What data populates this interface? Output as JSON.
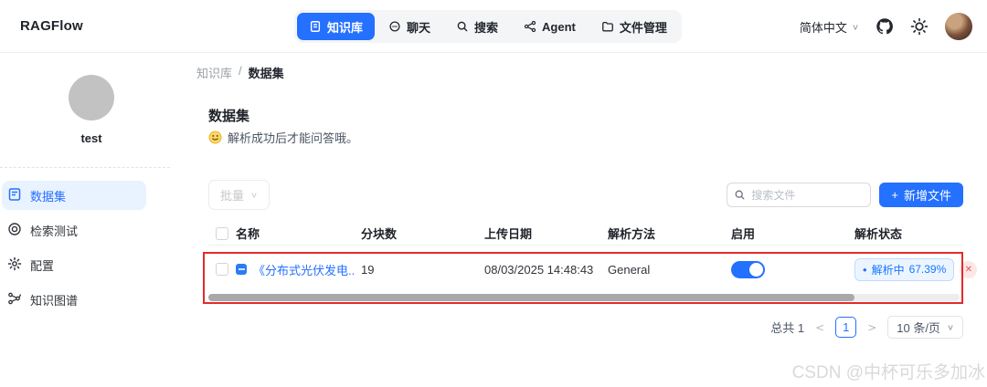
{
  "navbar": {
    "logo": "RAGFlow",
    "tabs": [
      {
        "label": "知识库",
        "icon": "knowledge-base-icon",
        "active": true
      },
      {
        "label": "聊天",
        "icon": "chat-icon",
        "active": false
      },
      {
        "label": "搜索",
        "icon": "search-icon",
        "active": false
      },
      {
        "label": "Agent",
        "icon": "agent-icon",
        "active": false
      },
      {
        "label": "文件管理",
        "icon": "file-manager-icon",
        "active": false
      }
    ],
    "language": "简体中文"
  },
  "sidebar": {
    "kb_name": "test",
    "items": [
      {
        "label": "数据集",
        "icon": "dataset-icon",
        "active": true
      },
      {
        "label": "检索测试",
        "icon": "retrieval-test-icon",
        "active": false
      },
      {
        "label": "配置",
        "icon": "settings-icon",
        "active": false
      },
      {
        "label": "知识图谱",
        "icon": "knowledge-graph-icon",
        "active": false
      }
    ]
  },
  "breadcrumb": {
    "parent": "知识库",
    "separator": "/",
    "current": "数据集"
  },
  "main": {
    "title": "数据集",
    "subtitle": "解析成功后才能问答哦。",
    "bulk_button": "批量",
    "search_placeholder": "搜索文件",
    "add_button_plus": "+",
    "add_button": "新增文件"
  },
  "table": {
    "headers": [
      "名称",
      "分块数",
      "上传日期",
      "解析方法",
      "启用",
      "解析状态"
    ],
    "rows": [
      {
        "name": "《分布式光伏发电...",
        "chunks": "19",
        "upload_date": "08/03/2025 14:48:43",
        "parse_method": "General",
        "enabled": true,
        "status_label": "解析中",
        "status_percent": "67.39%"
      }
    ]
  },
  "pagination": {
    "total": "总共 1",
    "prev": "<",
    "page": "1",
    "next": ">",
    "page_size": "10 条/页"
  },
  "icons": {
    "chevron": "∨",
    "close": "✕",
    "status_dot": "•"
  },
  "colors": {
    "accent": "#2470ff",
    "status_bg": "#ecf5ff",
    "status_text": "#1677ff",
    "danger": "#ef5350",
    "annotation_red": "#e22b2b",
    "sidebar_active_bg": "#e9f2ff"
  },
  "watermark": "CSDN @中杯可乐多加冰"
}
